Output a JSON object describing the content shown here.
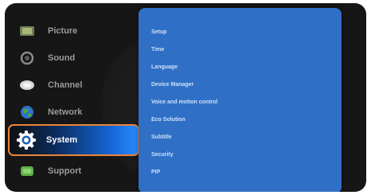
{
  "menu": {
    "items": [
      {
        "label": "Picture",
        "icon": "picture-icon"
      },
      {
        "label": "Sound",
        "icon": "sound-icon"
      },
      {
        "label": "Channel",
        "icon": "channel-icon"
      },
      {
        "label": "Network",
        "icon": "network-globe-icon"
      },
      {
        "label": "System",
        "icon": "gear-icon",
        "selected": true
      },
      {
        "label": "Support",
        "icon": "support-icon"
      }
    ]
  },
  "submenu": {
    "items": [
      "Setup",
      "Time",
      "Language",
      "Device Manager",
      "Voice and motion control",
      "Eco Solution",
      "Subtitle",
      "Security",
      "PIP"
    ]
  },
  "colors": {
    "highlight_border": "#e8863a",
    "submenu_bg": "#2f6fc6",
    "selected_gradient_end": "#2a8bff"
  }
}
